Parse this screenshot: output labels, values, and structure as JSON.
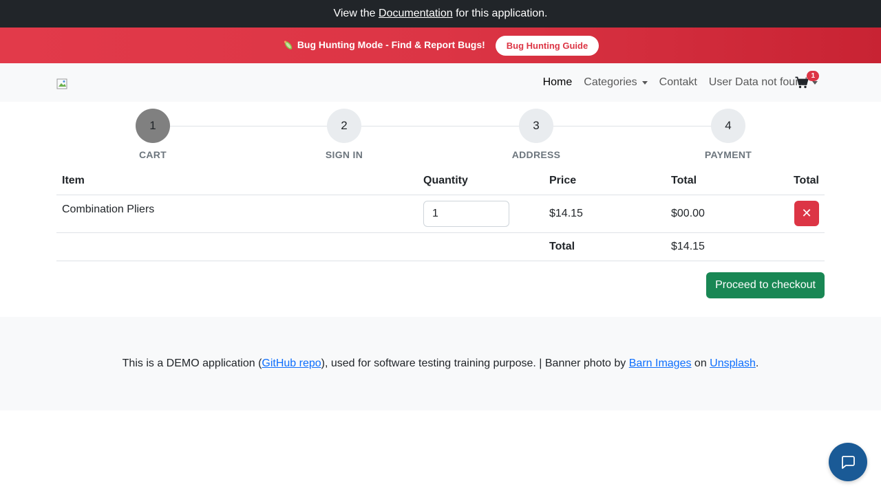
{
  "topbar": {
    "prefix": "View the",
    "link": "Documentation",
    "suffix": "for this application."
  },
  "bugbar": {
    "icon": "bug-icon",
    "text": "Bug Hunting Mode - Find & Report Bugs!",
    "button": "Bug Hunting Guide"
  },
  "nav": {
    "items": [
      {
        "label": "Home"
      },
      {
        "label": "Categories"
      },
      {
        "label": "Contakt"
      },
      {
        "label": "User Data not found"
      }
    ],
    "cart_count": "1"
  },
  "steps": [
    {
      "number": "1",
      "label": "CART"
    },
    {
      "number": "2",
      "label": "SIGN IN"
    },
    {
      "number": "3",
      "label": "ADDRESS"
    },
    {
      "number": "4",
      "label": "PAYMENT"
    }
  ],
  "table": {
    "headers": [
      "Item",
      "Quantity",
      "Price",
      "Total",
      "Total"
    ],
    "rows": [
      {
        "name": "Combination Pliers",
        "quantity": "1",
        "price": "$14.15",
        "total": "$00.00",
        "remove": "✕"
      }
    ],
    "total_label": "Total",
    "total_value": "$14.15"
  },
  "checkout": {
    "label": "Proceed to checkout"
  },
  "footer": {
    "prefix": "This is a DEMO application (",
    "repo_link": "GitHub repo",
    "middle": "), used for software testing training purpose. | Banner photo by",
    "author_link": "Barn Images",
    "on": "on",
    "site_link": "Unsplash",
    "end": "."
  },
  "colors": {
    "danger": "#dc3545",
    "success": "#198754",
    "dark": "#212529",
    "link": "#0d6efd",
    "chat": "#1a5a96"
  }
}
